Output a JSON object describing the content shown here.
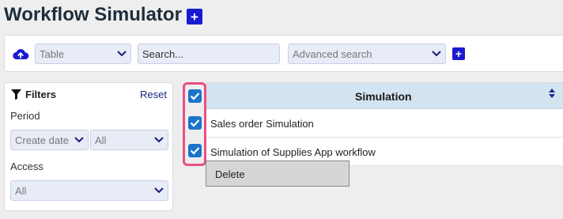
{
  "header": {
    "title": "Workflow Simulator"
  },
  "toolbar": {
    "view_select": {
      "value": "Table"
    },
    "search": {
      "placeholder": "Search..."
    },
    "advanced_search": {
      "placeholder": "Advanced search"
    }
  },
  "filters": {
    "title": "Filters",
    "reset_label": "Reset",
    "period_label": "Period",
    "period_field_value": "Create date",
    "period_range_value": "All",
    "access_label": "Access",
    "access_value": "All"
  },
  "table": {
    "column_header": "Simulation",
    "rows": [
      {
        "label": "Sales order Simulation",
        "checked": true
      },
      {
        "label": "Simulation of Supplies App workflow",
        "checked": true
      }
    ]
  },
  "context_menu": {
    "items": [
      {
        "label": "Delete"
      }
    ]
  },
  "colors": {
    "accent": "#1a1ad0",
    "checkbox": "#1a74c8",
    "highlight": "#ea4f85",
    "table_header": "#d3e3f0"
  }
}
